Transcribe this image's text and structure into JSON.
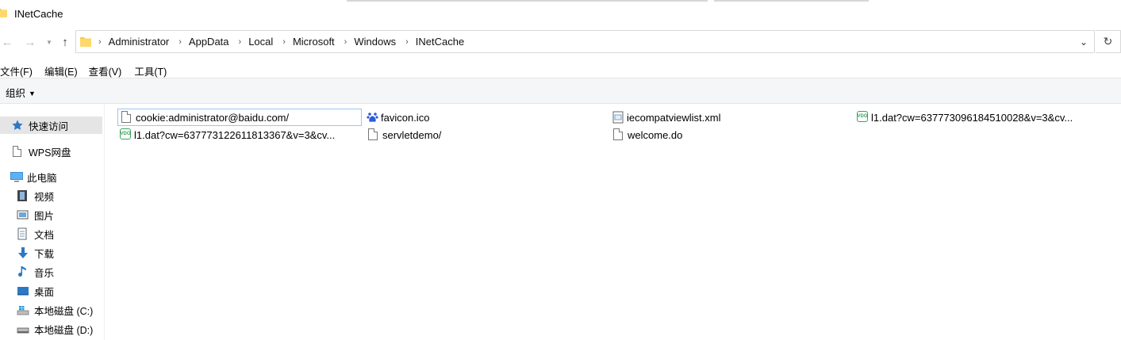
{
  "window": {
    "title": "INetCache"
  },
  "address": {
    "crumbs": [
      "Administrator",
      "AppData",
      "Local",
      "Microsoft",
      "Windows",
      "INetCache"
    ]
  },
  "menu": {
    "file": "文件(F)",
    "edit": "编辑(E)",
    "view": "查看(V)",
    "tools": "工具(T)"
  },
  "command": {
    "organize": "组织"
  },
  "sidebar": {
    "items": [
      {
        "label": "快速访问",
        "icon": "star-icon"
      },
      {
        "label": "WPS网盘",
        "icon": "document-icon"
      },
      {
        "label": "此电脑",
        "icon": "computer-icon"
      },
      {
        "label": "视频",
        "icon": "video-icon"
      },
      {
        "label": "图片",
        "icon": "picture-icon"
      },
      {
        "label": "文档",
        "icon": "document-icon"
      },
      {
        "label": "下载",
        "icon": "download-arrow-icon"
      },
      {
        "label": "音乐",
        "icon": "music-note-icon"
      },
      {
        "label": "桌面",
        "icon": "desktop-icon"
      },
      {
        "label": "本地磁盘 (C:)",
        "icon": "windows-drive-icon"
      },
      {
        "label": "本地磁盘 (D:)",
        "icon": "drive-icon"
      }
    ]
  },
  "files": [
    {
      "name": "cookie:administrator@baidu.com/",
      "icon": "blank-file-icon"
    },
    {
      "name": "favicon.ico",
      "icon": "baidu-paw-icon"
    },
    {
      "name": "iecompatviewlist.xml",
      "icon": "xml-file-icon"
    },
    {
      "name": "l1.dat?cw=637773096184510028&v=3&cv...",
      "icon": "vdo-file-icon"
    },
    {
      "name": "l1.dat?cw=637773122611813367&v=3&cv...",
      "icon": "vdo-file-icon"
    },
    {
      "name": "servletdemo/",
      "icon": "blank-file-icon"
    },
    {
      "name": "welcome.do",
      "icon": "blank-file-icon"
    }
  ],
  "colors": {
    "accent": "#1e73c7",
    "selection": "#e5e5e5",
    "focus_border": "#99c7ef",
    "vdo_green": "#3aa35d"
  }
}
